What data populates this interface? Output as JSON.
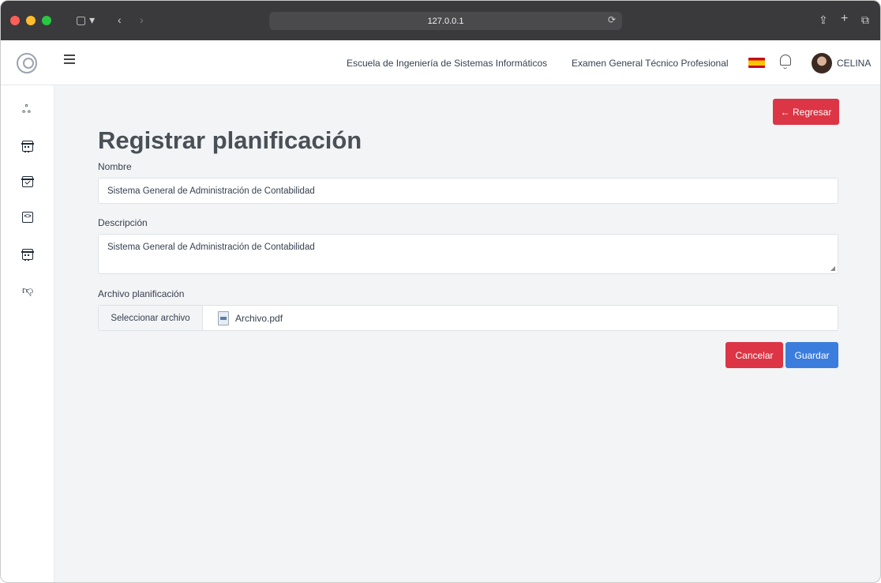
{
  "browser": {
    "url": "127.0.0.1"
  },
  "header": {
    "nav": [
      "Escuela de Ingeniería de Sistemas Informáticos",
      "Examen General Técnico Profesional"
    ],
    "username": "CELINA"
  },
  "sidebar": {
    "icons": [
      "users-icon",
      "calendar-icon",
      "calendar-check-icon",
      "code-icon",
      "calendar-icon",
      "thumbs-down-icon"
    ]
  },
  "page": {
    "back_button": "← Regresar",
    "title": "Registrar planificación",
    "name_label": "Nombre",
    "name_value": "Sistema General de Administración de Contabilidad",
    "description_label": "Descripción",
    "description_value": "Sistema General de Administración de Contabilidad",
    "file_label": "Archivo planificación",
    "file_button": "Seleccionar archivo",
    "file_name": "Archivo.pdf",
    "cancel_button": "Cancelar",
    "save_button": "Guardar"
  },
  "colors": {
    "danger": "#dc3545",
    "primary": "#3b7ddd",
    "background": "#f3f4f6"
  }
}
